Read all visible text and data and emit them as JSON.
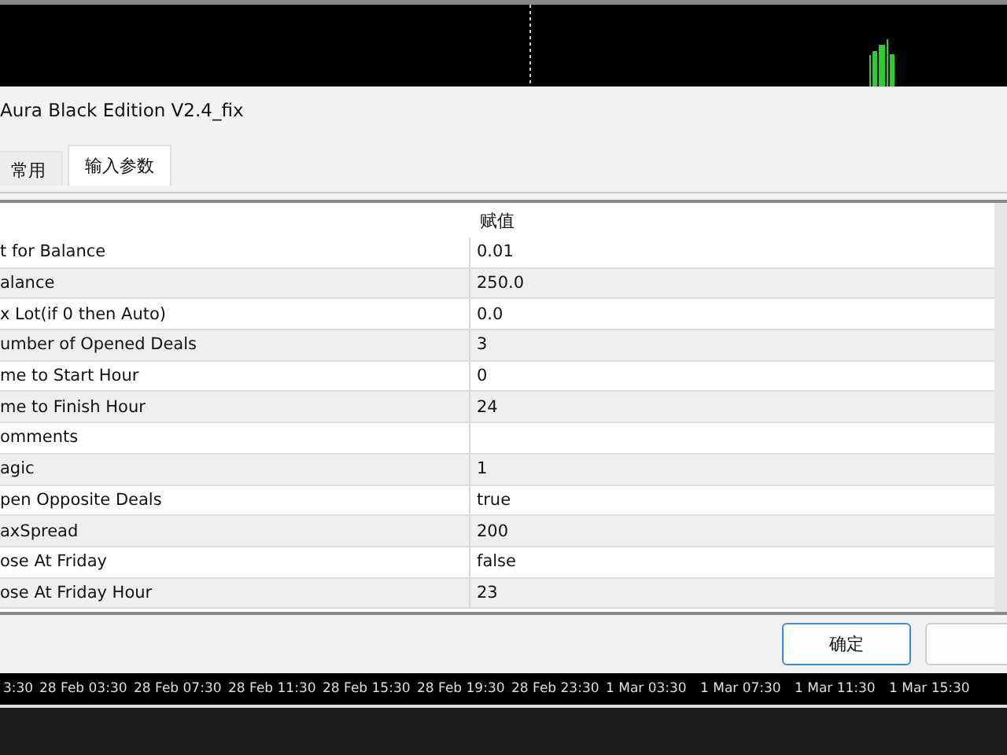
{
  "dialog": {
    "title": "Aura Black Edition V2.4_fix"
  },
  "tabs": [
    {
      "label": "常用",
      "selected": false
    },
    {
      "label": "输入参数",
      "selected": true
    }
  ],
  "table": {
    "columns": [
      "赋值"
    ],
    "rows": [
      {
        "name": "t for Balance",
        "value": "0.01"
      },
      {
        "name": "alance",
        "value": "250.0"
      },
      {
        "name": "x Lot(if 0 then Auto)",
        "value": "0.0"
      },
      {
        "name": "umber of Opened Deals",
        "value": "3"
      },
      {
        "name": "me to Start Hour",
        "value": "0"
      },
      {
        "name": "me to Finish Hour",
        "value": "24"
      },
      {
        "name": "omments"
      },
      {
        "name": "agic",
        "value": "1"
      },
      {
        "name": "pen Opposite Deals",
        "value": "true"
      },
      {
        "name": "axSpread",
        "value": "200"
      },
      {
        "name": "ose At Friday",
        "value": "false"
      },
      {
        "name": "ose At Friday Hour",
        "value": "23"
      }
    ]
  },
  "buttons": [
    {
      "label": "确定"
    }
  ],
  "time_axis": [
    "3:30",
    "28 Feb 03:30",
    "28 Feb 07:30",
    "28 Feb 11:30",
    "28 Feb 15:30",
    "28 Feb 19:30",
    "28 Feb 23:30",
    "1 Mar 03:30",
    "1 Mar 07:30",
    "1 Mar 11:30",
    "1 Mar 15:30"
  ]
}
